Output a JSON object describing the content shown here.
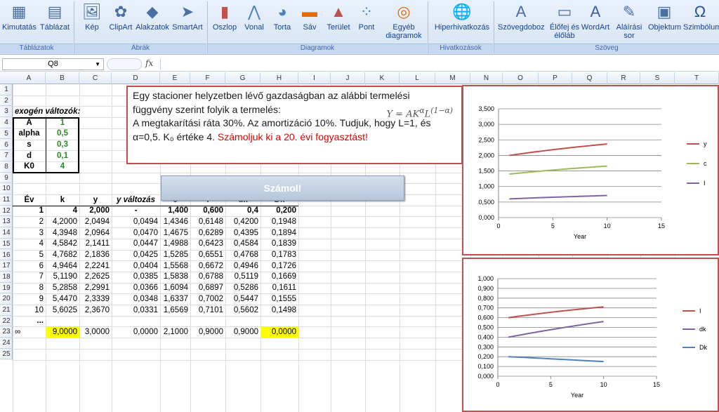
{
  "ribbon": {
    "buttons": [
      {
        "id": "kimutatas",
        "label": "Kimutatás",
        "icon": "pivot-table-icon"
      },
      {
        "id": "tablazat",
        "label": "Táblázat",
        "icon": "table-icon"
      },
      {
        "id": "kep",
        "label": "Kép",
        "icon": "picture-icon"
      },
      {
        "id": "clipart",
        "label": "ClipArt",
        "icon": "clipart-icon"
      },
      {
        "id": "alakzatok",
        "label": "Alakzatok",
        "icon": "shapes-icon"
      },
      {
        "id": "smartart",
        "label": "SmartArt",
        "icon": "smartart-icon"
      },
      {
        "id": "oszlop",
        "label": "Oszlop",
        "icon": "column-chart-icon"
      },
      {
        "id": "vonal",
        "label": "Vonal",
        "icon": "line-chart-icon"
      },
      {
        "id": "torta",
        "label": "Torta",
        "icon": "pie-chart-icon"
      },
      {
        "id": "sav",
        "label": "Sáv",
        "icon": "bar-chart-icon"
      },
      {
        "id": "terulet",
        "label": "Terület",
        "icon": "area-chart-icon"
      },
      {
        "id": "pont",
        "label": "Pont",
        "icon": "scatter-chart-icon"
      },
      {
        "id": "egyeb",
        "label": "Egyéb diagramok",
        "icon": "other-charts-icon"
      },
      {
        "id": "hiper",
        "label": "Hiperhivatkozás",
        "icon": "hyperlink-icon"
      },
      {
        "id": "szovegdoboz",
        "label": "Szövegdoboz",
        "icon": "textbox-icon"
      },
      {
        "id": "elofej",
        "label": "Élőfej és élőláb",
        "icon": "header-footer-icon"
      },
      {
        "id": "wordart",
        "label": "WordArt",
        "icon": "wordart-icon"
      },
      {
        "id": "alairasi",
        "label": "Aláírási sor",
        "icon": "signature-icon"
      },
      {
        "id": "objektum",
        "label": "Objektum",
        "icon": "object-icon"
      },
      {
        "id": "szimbolum",
        "label": "Szimbólum",
        "icon": "omega-icon"
      }
    ],
    "groups": [
      "Táblázatok",
      "Ábrák",
      "Diagramok",
      "Hivatkozások",
      "Szöveg"
    ]
  },
  "formula_bar": {
    "name_box": "Q8",
    "fx": "fx",
    "formula": ""
  },
  "columns": [
    "A",
    "B",
    "C",
    "D",
    "E",
    "F",
    "G",
    "H",
    "I",
    "J",
    "K",
    "L",
    "M",
    "N",
    "O",
    "P",
    "Q",
    "R",
    "S",
    "T"
  ],
  "rows": [
    "1",
    "2",
    "3",
    "4",
    "5",
    "6",
    "7",
    "8",
    "9",
    "10",
    "11",
    "12",
    "13",
    "14",
    "15",
    "16",
    "17",
    "18",
    "19",
    "20",
    "21",
    "22",
    "23",
    "24",
    "25"
  ],
  "exogen": {
    "title": "exogén változók:",
    "items": [
      {
        "name": "A",
        "value": "1"
      },
      {
        "name": "alpha",
        "value": "0,5"
      },
      {
        "name": "s",
        "value": "0,3"
      },
      {
        "name": "d",
        "value": "0,1"
      },
      {
        "name": "K0",
        "value": "4"
      }
    ]
  },
  "textbox": {
    "line1": "Egy stacioner helyzetben lévő gazdaságban az alábbi termelési",
    "line2": "függvény szerint folyik a termelés:",
    "line3": "A megtakarítási ráta 30%. Az amortizáció 10%. Tudjuk, hogy L=1, és",
    "line4a": "α=0,5. K₀ értéke 4. ",
    "line4b": "Számoljuk ki a 20. évi fogyasztást!",
    "formula": "Y = AK^α L^(1−α)"
  },
  "calc_button": "Számol!",
  "table": {
    "headers": [
      "Év",
      "k",
      "y",
      "y változás",
      "c",
      "I",
      "dk",
      "Dk"
    ],
    "rows": [
      [
        "1",
        "4",
        "2,000",
        "-",
        "1,400",
        "0,600",
        "0,4",
        "0,200"
      ],
      [
        "2",
        "4,2000",
        "2,0494",
        "0,0494",
        "1,4346",
        "0,6148",
        "0,4200",
        "0,1948"
      ],
      [
        "3",
        "4,3948",
        "2,0964",
        "0,0470",
        "1,4675",
        "0,6289",
        "0,4395",
        "0,1894"
      ],
      [
        "4",
        "4,5842",
        "2,1411",
        "0,0447",
        "1,4988",
        "0,6423",
        "0,4584",
        "0,1839"
      ],
      [
        "5",
        "4,7682",
        "2,1836",
        "0,0425",
        "1,5285",
        "0,6551",
        "0,4768",
        "0,1783"
      ],
      [
        "6",
        "4,9464",
        "2,2241",
        "0,0404",
        "1,5568",
        "0,6672",
        "0,4946",
        "0,1726"
      ],
      [
        "7",
        "5,1190",
        "2,2625",
        "0,0385",
        "1,5838",
        "0,6788",
        "0,5119",
        "0,1669"
      ],
      [
        "8",
        "5,2858",
        "2,2991",
        "0,0366",
        "1,6094",
        "0,6897",
        "0,5286",
        "0,1611"
      ],
      [
        "9",
        "5,4470",
        "2,3339",
        "0,0348",
        "1,6337",
        "0,7002",
        "0,5447",
        "0,1555"
      ],
      [
        "10",
        "5,6025",
        "2,3670",
        "0,0331",
        "1,6569",
        "0,7101",
        "0,5602",
        "0,1498"
      ]
    ],
    "ellipsis": "...",
    "inf_label": "∞",
    "steady": [
      "9,0000",
      "3,0000",
      "0,0000",
      "2,1000",
      "0,9000",
      "0,9000",
      "0,0000"
    ]
  },
  "chart_data": [
    {
      "type": "line",
      "xlabel": "Year",
      "xlim": [
        0,
        15
      ],
      "xticks": [
        "0",
        "5",
        "10",
        "15"
      ],
      "ylim": [
        0,
        3.5
      ],
      "yticks": [
        "0,000",
        "0,500",
        "1,000",
        "1,500",
        "2,000",
        "2,500",
        "3,000",
        "3,500"
      ],
      "legend": "right",
      "x": [
        1,
        2,
        3,
        4,
        5,
        6,
        7,
        8,
        9,
        10
      ],
      "series": [
        {
          "name": "y",
          "color": "#c0504d",
          "values": [
            2.0,
            2.0494,
            2.0964,
            2.1411,
            2.1836,
            2.2241,
            2.2625,
            2.2991,
            2.3339,
            2.367
          ]
        },
        {
          "name": "c",
          "color": "#9bbb59",
          "values": [
            1.4,
            1.4346,
            1.4675,
            1.4988,
            1.5285,
            1.5568,
            1.5838,
            1.6094,
            1.6337,
            1.6569
          ]
        },
        {
          "name": "I",
          "color": "#8064a2",
          "values": [
            0.6,
            0.6148,
            0.6289,
            0.6423,
            0.6551,
            0.6672,
            0.6788,
            0.6897,
            0.7002,
            0.7101
          ]
        }
      ]
    },
    {
      "type": "line",
      "xlabel": "Year",
      "xlim": [
        0,
        15
      ],
      "xticks": [
        "0",
        "5",
        "10",
        "15"
      ],
      "ylim": [
        0,
        1.0
      ],
      "yticks": [
        "0,000",
        "0,100",
        "0,200",
        "0,300",
        "0,400",
        "0,500",
        "0,600",
        "0,700",
        "0,800",
        "0,900",
        "1,000"
      ],
      "legend": "right",
      "x": [
        1,
        2,
        3,
        4,
        5,
        6,
        7,
        8,
        9,
        10
      ],
      "series": [
        {
          "name": "I",
          "color": "#c0504d",
          "values": [
            0.6,
            0.6148,
            0.6289,
            0.6423,
            0.6551,
            0.6672,
            0.6788,
            0.6897,
            0.7002,
            0.7101
          ]
        },
        {
          "name": "dk",
          "color": "#8064a2",
          "values": [
            0.4,
            0.42,
            0.4395,
            0.4584,
            0.4768,
            0.4946,
            0.5119,
            0.5286,
            0.5447,
            0.5602
          ]
        },
        {
          "name": "Dk",
          "color": "#4f81bd",
          "values": [
            0.2,
            0.1948,
            0.1894,
            0.1839,
            0.1783,
            0.1726,
            0.1669,
            0.1611,
            0.1555,
            0.1498
          ]
        }
      ]
    }
  ]
}
